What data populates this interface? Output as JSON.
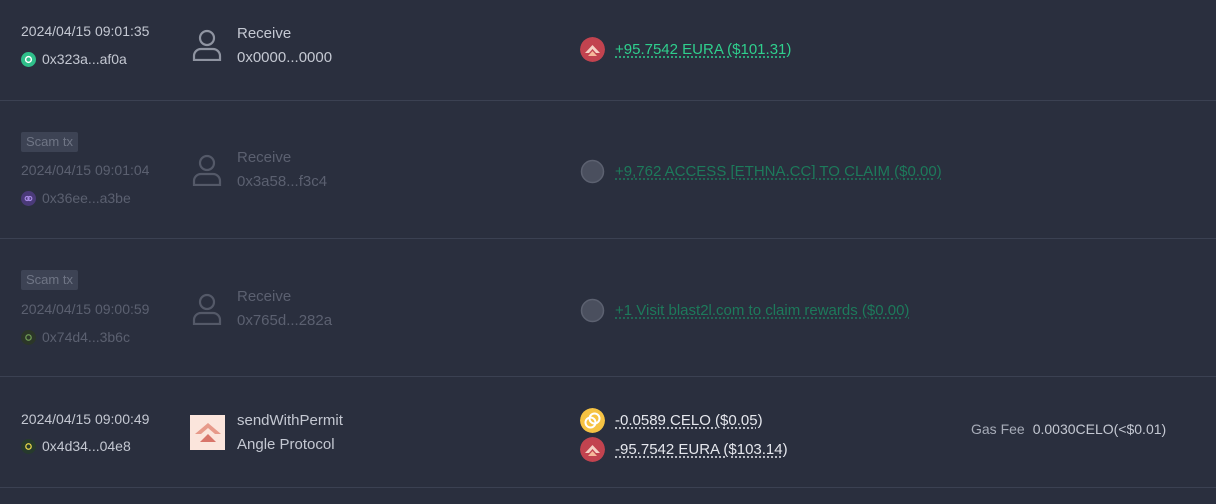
{
  "transactions": [
    {
      "scam": false,
      "time": "2024/04/15 09:01:35",
      "address": "0x323a...af0a",
      "chain_color": "#2fbf8a",
      "operation": "Receive",
      "counterparty": "0x0000...0000",
      "tokens": [
        {
          "icon": "eura-token-icon",
          "amount": "+95.7542 EURA ($101.31)",
          "direction": "in"
        }
      ]
    },
    {
      "scam": true,
      "badge": "Scam tx",
      "time": "2024/04/15 09:01:04",
      "address": "0x36ee...a3be",
      "chain_color": "#7b4fd1",
      "operation": "Receive",
      "counterparty": "0x3a58...f3c4",
      "tokens": [
        {
          "icon": "unknown-token-icon",
          "amount": "+9,762 ACCESS [ETHNA.CC] TO CLAIM ($0.00)",
          "direction": "in"
        }
      ]
    },
    {
      "scam": true,
      "badge": "Scam tx",
      "time": "2024/04/15 09:00:59",
      "address": "0x74d4...3b6c",
      "chain_color": "#3d5a3a",
      "operation": "Receive",
      "counterparty": "0x765d...282a",
      "tokens": [
        {
          "icon": "unknown-token-icon",
          "amount": "+1 Visit blast2l.com to claim rewards ($0.00)",
          "direction": "in"
        }
      ]
    },
    {
      "scam": false,
      "time": "2024/04/15 09:00:49",
      "address": "0x4d34...04e8",
      "chain_color": "#35d07f",
      "operation": "sendWithPermit",
      "counterparty": "Angle Protocol",
      "app_icon": "angle-protocol-logo",
      "tokens": [
        {
          "icon": "celo-token-icon",
          "amount": "-0.0589 CELO ($0.05)",
          "direction": "out"
        },
        {
          "icon": "eura-token-icon",
          "amount": "-95.7542 EURA ($103.14)",
          "direction": "out"
        }
      ],
      "gas_label": "Gas Fee",
      "gas_value": "0.0030CELO(<$0.01)"
    }
  ],
  "colors": {
    "background": "#2a2f3e",
    "incoming": "#2fcf8d",
    "outgoing": "#e6e8ee",
    "divider": "#3b4152"
  }
}
